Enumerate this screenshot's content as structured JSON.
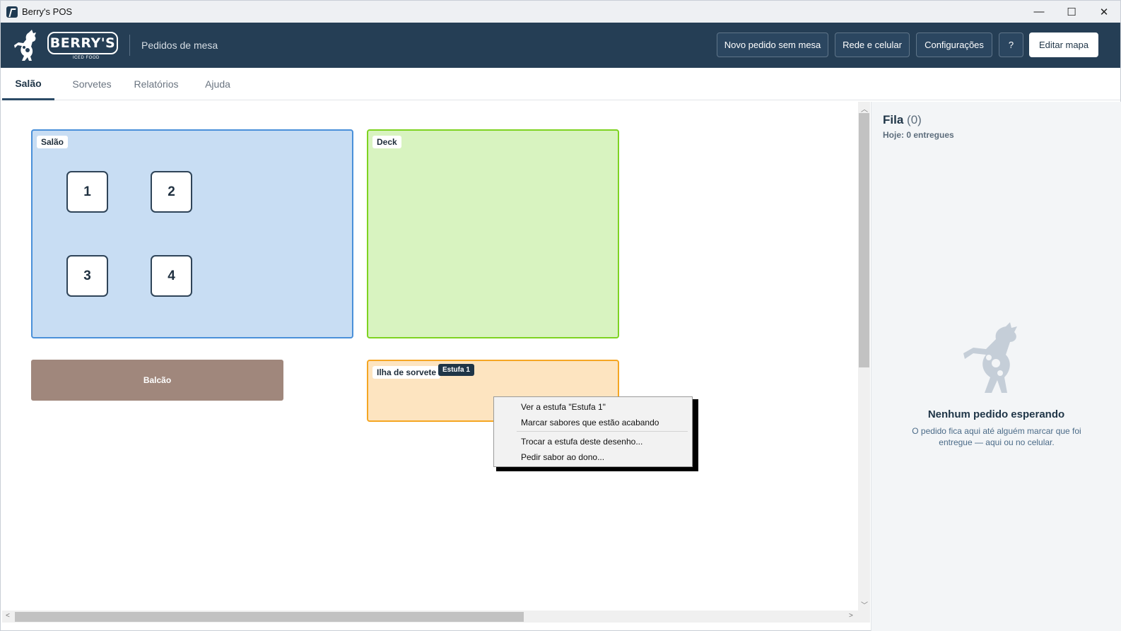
{
  "window": {
    "title": "Berry's POS",
    "controls": [
      "—",
      "☐",
      "✕"
    ]
  },
  "header": {
    "logo_text": "BERRY'S",
    "logo_sub": "ICED FOOD",
    "section_title": "Pedidos de mesa",
    "buttons": {
      "new_order": "Novo pedido sem mesa",
      "network": "Rede e celular",
      "settings": "Configurações",
      "help": "?",
      "edit_map": "Editar mapa"
    }
  },
  "tabs": [
    {
      "label": "Salão",
      "active": true
    },
    {
      "label": "Sorvetes",
      "active": false
    },
    {
      "label": "Relatórios",
      "active": false
    },
    {
      "label": "Ajuda",
      "active": false
    }
  ],
  "map": {
    "zones": {
      "salao": {
        "label": "Salão",
        "fill": "#c8ddf3",
        "border": "#4a90d9"
      },
      "deck": {
        "label": "Deck",
        "fill": "#d8f3c0",
        "border": "#7ed321"
      },
      "balcao": {
        "label": "Balcão",
        "fill": "#a0877c"
      },
      "ilha": {
        "label": "Ilha de sorvete",
        "badge": "Estufa 1",
        "fill": "#fde4c0",
        "border": "#f5a623"
      }
    },
    "tables": [
      "1",
      "2",
      "3",
      "4"
    ]
  },
  "context_menu": {
    "items": [
      "Ver a estufa \"Estufa 1\"",
      "Marcar sabores que estão acabando",
      "Trocar a estufa deste desenho...",
      "Pedir sabor ao dono..."
    ]
  },
  "queue": {
    "title": "Fila",
    "count": "(0)",
    "today": "Hoje: 0 entregues",
    "empty_title": "Nenhum pedido esperando",
    "empty_text": "O pedido fica aqui até alguém marcar que foi entregue — aqui ou no celular."
  }
}
